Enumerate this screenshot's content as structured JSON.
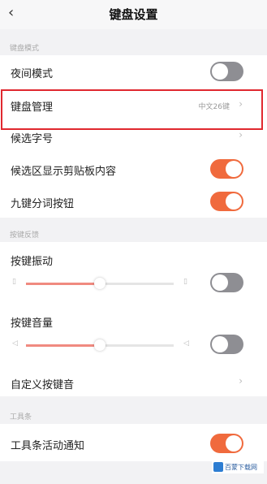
{
  "header": {
    "title": "键盘设置",
    "back_icon": "back-chevron-icon"
  },
  "sections": {
    "keyboard_mode": "键盘模式",
    "key_feedback": "按键反馈",
    "toolbar": "工具条"
  },
  "rows": {
    "night_mode": {
      "label": "夜间模式",
      "toggle": false
    },
    "keyboard_management": {
      "label": "键盘管理",
      "value": "中文26键"
    },
    "candidate_font": {
      "label": "候选字号"
    },
    "candidate_clipboard": {
      "label": "候选区显示剪贴板内容",
      "toggle": true
    },
    "nine_key_split": {
      "label": "九键分词按钮",
      "toggle": true
    },
    "key_vibration": {
      "label": "按键振动",
      "toggle": false,
      "level": 0.5
    },
    "key_volume": {
      "label": "按键音量",
      "toggle": false,
      "level": 0.5
    },
    "custom_key_sound": {
      "label": "自定义按键音"
    },
    "toolbar_notify": {
      "label": "工具条活动通知",
      "toggle": true
    }
  },
  "watermark": {
    "text": "百蒙下载网"
  },
  "colors": {
    "accent": "#f06a3d",
    "highlight": "#e0282f",
    "toggle_off": "#8e8e93"
  }
}
